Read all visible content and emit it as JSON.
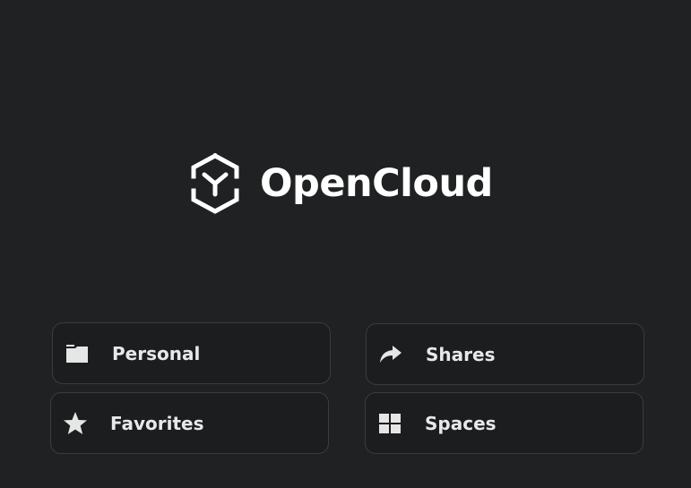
{
  "brand": {
    "name": "OpenCloud"
  },
  "tiles": [
    {
      "label": "Personal",
      "icon": "folder-icon"
    },
    {
      "label": "Shares",
      "icon": "share-arrow-icon"
    },
    {
      "label": "Favorites",
      "icon": "star-icon"
    },
    {
      "label": "Spaces",
      "icon": "grid-icon"
    }
  ],
  "colors": {
    "background": "#1f2122",
    "tile_background": "#1b1d1e",
    "tile_border": "#3a3d3f",
    "text": "#e8e8e8",
    "icon": "#e6e6e6"
  }
}
